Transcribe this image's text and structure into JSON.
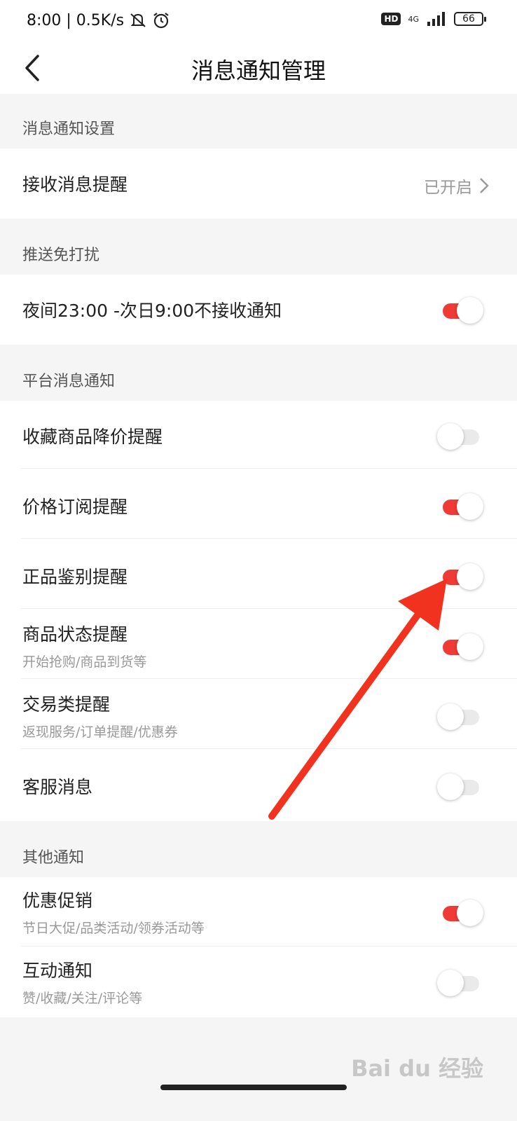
{
  "status_bar": {
    "time_speed": "8:00 | 0.5K/s",
    "hd": "HD",
    "network": "4G",
    "battery": "66"
  },
  "header": {
    "title": "消息通知管理"
  },
  "sections": {
    "notify_settings": {
      "label": "消息通知设置",
      "receive": {
        "title": "接收消息提醒",
        "status": "已开启"
      }
    },
    "dnd": {
      "label": "推送免打扰",
      "night": {
        "title": "夜间23:00 -次日9:00不接收通知",
        "enabled": true
      }
    },
    "platform": {
      "label": "平台消息通知",
      "items": [
        {
          "title": "收藏商品降价提醒",
          "enabled": false
        },
        {
          "title": "价格订阅提醒",
          "enabled": true
        },
        {
          "title": "正品鉴别提醒",
          "enabled": true
        },
        {
          "title": "商品状态提醒",
          "subtitle": "开始抢购/商品到货等",
          "enabled": true
        },
        {
          "title": "交易类提醒",
          "subtitle": "返现服务/订单提醒/优惠券",
          "enabled": false
        },
        {
          "title": "客服消息",
          "enabled": false
        }
      ]
    },
    "other": {
      "label": "其他通知",
      "items": [
        {
          "title": "优惠促销",
          "subtitle": "节日大促/品类活动/领券活动等",
          "enabled": true
        },
        {
          "title": "互动通知",
          "subtitle": "赞/收藏/关注/评论等",
          "enabled": false
        }
      ]
    }
  },
  "watermark": "Bai du 经验",
  "colors": {
    "accent": "#f03a36",
    "arrow": "#f0321e",
    "background": "#f5f5f5"
  }
}
